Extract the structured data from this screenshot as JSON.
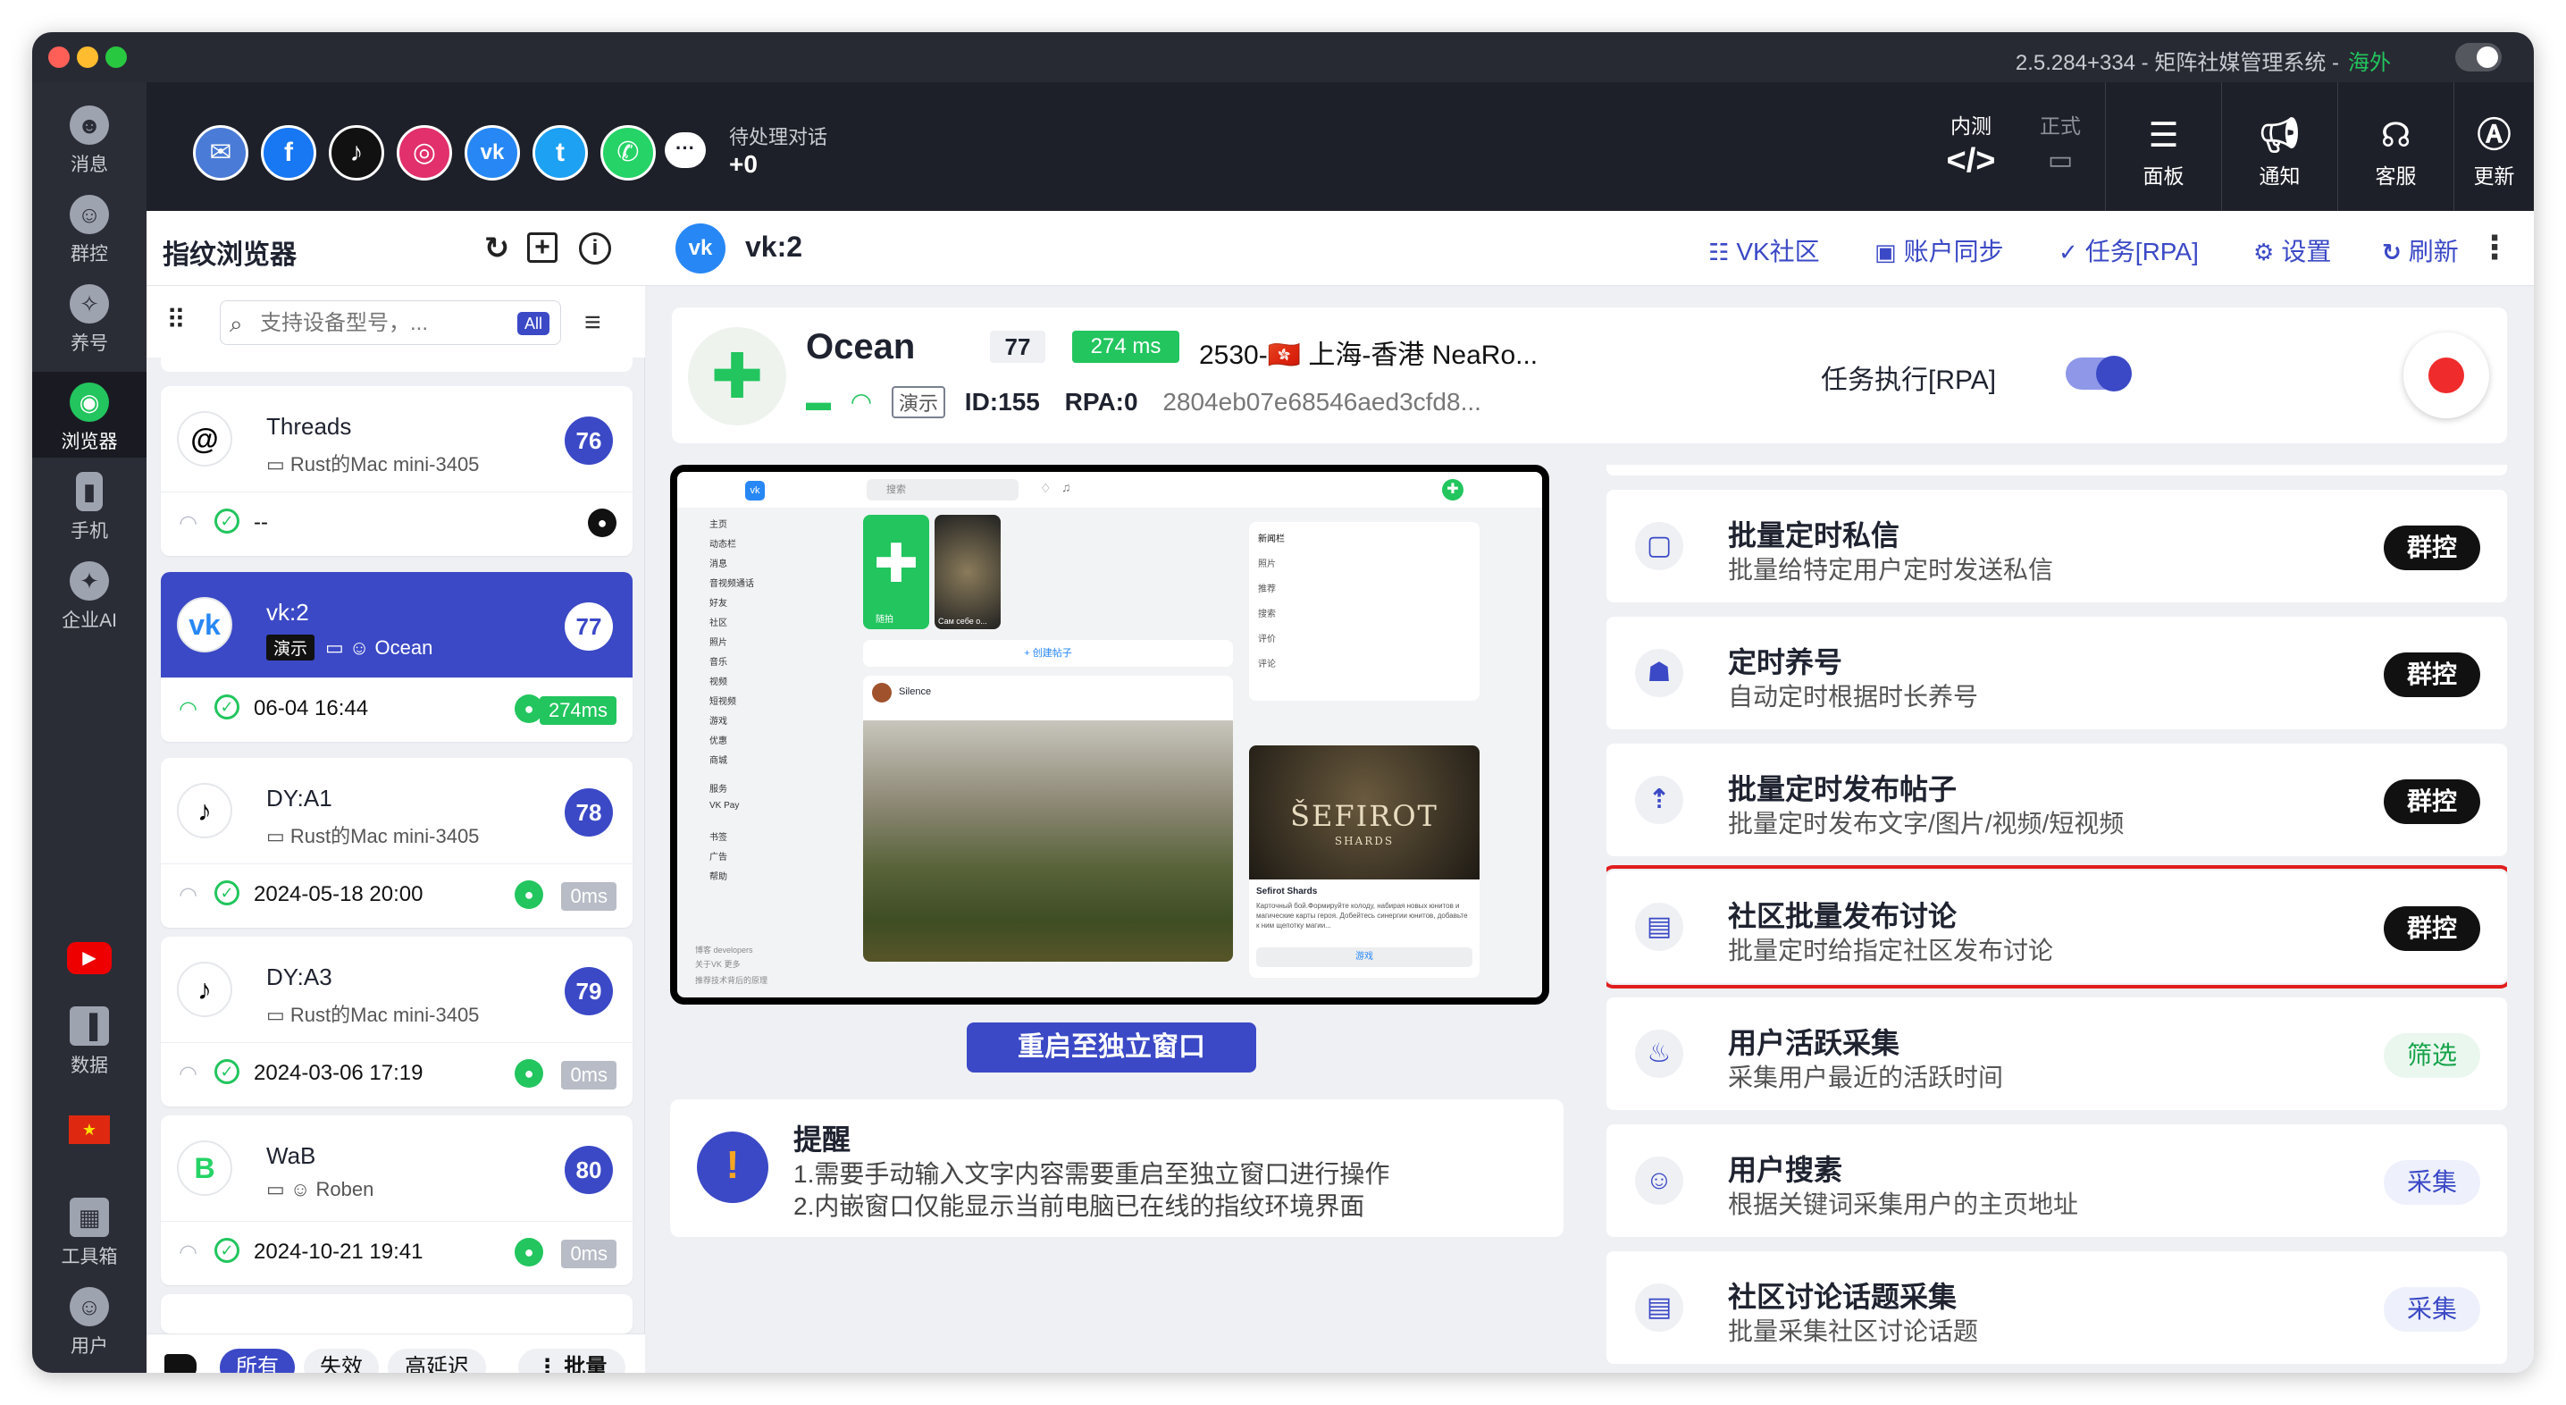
{
  "window": {
    "title": "2.5.284+334 - 矩阵社媒管理系统 -",
    "region": "海外"
  },
  "sidebar": {
    "items": [
      {
        "label": "消息",
        "icon": "message-icon"
      },
      {
        "label": "群控",
        "icon": "group-control-icon"
      },
      {
        "label": "养号",
        "icon": "nurture-account-icon"
      },
      {
        "label": "浏览器",
        "icon": "browser-icon"
      },
      {
        "label": "手机",
        "icon": "phone-icon"
      },
      {
        "label": "企业AI",
        "icon": "enterprise-ai-icon"
      },
      {
        "label": "数据",
        "icon": "data-chart-icon"
      },
      {
        "label": "工具箱",
        "icon": "toolbox-icon"
      },
      {
        "label": "用户",
        "icon": "user-icon"
      }
    ]
  },
  "social": [
    {
      "name": "email-app-icon",
      "glyph": "✉",
      "color": "#4a7bd6"
    },
    {
      "name": "facebook-icon",
      "glyph": "f",
      "color": "#1877f2"
    },
    {
      "name": "tiktok-icon",
      "glyph": "♪",
      "color": "#111111"
    },
    {
      "name": "instagram-icon",
      "glyph": "◎",
      "color": "#e1306c"
    },
    {
      "name": "vk-icon",
      "glyph": "vk",
      "color": "#2787f5"
    },
    {
      "name": "twitter-icon",
      "glyph": "t",
      "color": "#1da1f2"
    },
    {
      "name": "whatsapp-icon",
      "glyph": "✆",
      "color": "#25d366"
    }
  ],
  "pending": {
    "label": "待处理对话",
    "value": "+0"
  },
  "topbar": {
    "beta": "内测",
    "release": "正式",
    "panel": "面板",
    "notice": "通知",
    "service": "客服",
    "update": "更新"
  },
  "browser_panel": {
    "title": "指纹浏览器",
    "search_placeholder": "支持设备型号，...",
    "search_scope": "All",
    "cards": [
      {
        "name": "Threads",
        "device": "Rust的Mac mini-3405",
        "num": "76",
        "time": "--",
        "ms": ""
      },
      {
        "name": "vk:2",
        "demo": "演示",
        "owner": "Ocean",
        "num": "77",
        "time": "06-04 16:44",
        "ms": "274ms"
      },
      {
        "name": "DY:A1",
        "device": "Rust的Mac mini-3405",
        "num": "78",
        "time": "2024-05-18 20:00",
        "ms": "0ms"
      },
      {
        "name": "DY:A3",
        "device": "Rust的Mac mini-3405",
        "num": "79",
        "time": "2024-03-06 17:19",
        "ms": "0ms"
      },
      {
        "name": "WaB",
        "owner": "Roben",
        "num": "80",
        "time": "2024-10-21 19:41",
        "ms": "0ms"
      }
    ],
    "filters": {
      "all": "所有",
      "invalid": "失效",
      "high_latency": "高延迟",
      "batch": "批量"
    }
  },
  "main": {
    "account": "vk:2",
    "actions": {
      "community": "VK社区",
      "sync": "账户同步",
      "task": "任务[RPA]",
      "settings": "设置",
      "refresh": "刷新"
    },
    "profile": {
      "name": "Ocean",
      "num": "77",
      "latency": "274 ms",
      "location": "2530-🇭🇰 上海-香港 NeaRo...",
      "demo": "演示",
      "id": "ID:155",
      "rpa": "RPA:0",
      "hash": "2804eb07e68546aed3cfd8...",
      "rpa_label": "任务执行[RPA]"
    },
    "restart_label": "重启至独立窗口",
    "reminder": {
      "title": "提醒",
      "line1": "1.需要手动输入文字内容需要重启至独立窗口进行操作",
      "line2": "2.内嵌窗口仅能显示当前电脑已在线的指纹环境界面"
    },
    "tasks": [
      {
        "title": "批量定时私信",
        "desc": "批量给特定用户定时发送私信",
        "badge": "群控",
        "icon": "chat-bubble-icon"
      },
      {
        "title": "定时养号",
        "desc": "自动定时根据时长养号",
        "badge": "群控",
        "icon": "robot-icon"
      },
      {
        "title": "批量定时发布帖子",
        "desc": "批量定时发布文字/图片/视频/短视频",
        "badge": "群控",
        "icon": "upload-icon"
      },
      {
        "title": "社区批量发布讨论",
        "desc": "批量定时给指定社区发布讨论",
        "badge": "群控",
        "icon": "post-add-icon"
      },
      {
        "title": "用户活跃采集",
        "desc": "采集用户最近的活跃时间",
        "badge": "筛选",
        "icon": "flame-icon"
      },
      {
        "title": "用户搜素",
        "desc": "根据关键词采集用户的主页地址",
        "badge": "采集",
        "icon": "person-icon"
      },
      {
        "title": "社区讨论话题采集",
        "desc": "批量采集社区讨论话题",
        "badge": "采集",
        "icon": "topic-add-icon"
      }
    ]
  },
  "preview": {
    "search": "搜索",
    "menu": [
      "主页",
      "动态栏",
      "消息",
      "音视频通话",
      "好友",
      "社区",
      "照片",
      "音乐",
      "视频",
      "短视频",
      "游戏",
      "优惠",
      "商城",
      "服务",
      "VK Pay",
      "书签",
      "广告",
      "帮助"
    ],
    "story1": "随拍",
    "story2": "Сам себе о...",
    "create_post": "创建帖子",
    "post_author": "Silence",
    "side_box": [
      "新闻栏",
      "照片",
      "推荐",
      "搜索",
      "评价",
      "评论"
    ],
    "ad_title": "ŠEFIROT",
    "ad_sub": "SHARDS",
    "ad_name": "Sefirot Shards",
    "ad_text": "Карточный бой.Формируйте колоду, набирая новых юнитов и магические карты героя. Добейтесь синергии юнитов, добавьте к ним щепотку магии...",
    "ad_btn": "游戏",
    "footer": "博客 developers",
    "footer2": "关于VK 更多",
    "footer3": "推荐技术背后的原理"
  }
}
